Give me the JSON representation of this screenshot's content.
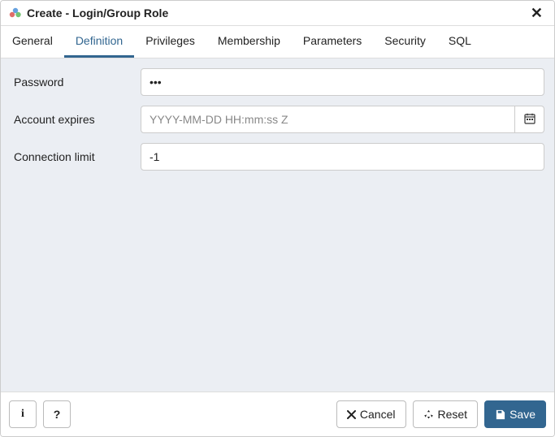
{
  "header": {
    "title": "Create - Login/Group Role"
  },
  "tabs": [
    {
      "label": "General",
      "active": false
    },
    {
      "label": "Definition",
      "active": true
    },
    {
      "label": "Privileges",
      "active": false
    },
    {
      "label": "Membership",
      "active": false
    },
    {
      "label": "Parameters",
      "active": false
    },
    {
      "label": "Security",
      "active": false
    },
    {
      "label": "SQL",
      "active": false
    }
  ],
  "form": {
    "password": {
      "label": "Password",
      "value": "•••"
    },
    "account_expires": {
      "label": "Account expires",
      "placeholder": "YYYY-MM-DD HH:mm:ss Z",
      "value": ""
    },
    "connection_limit": {
      "label": "Connection limit",
      "value": "-1"
    }
  },
  "footer": {
    "info_label": "i",
    "help_label": "?",
    "cancel_label": "Cancel",
    "reset_label": "Reset",
    "save_label": "Save"
  }
}
